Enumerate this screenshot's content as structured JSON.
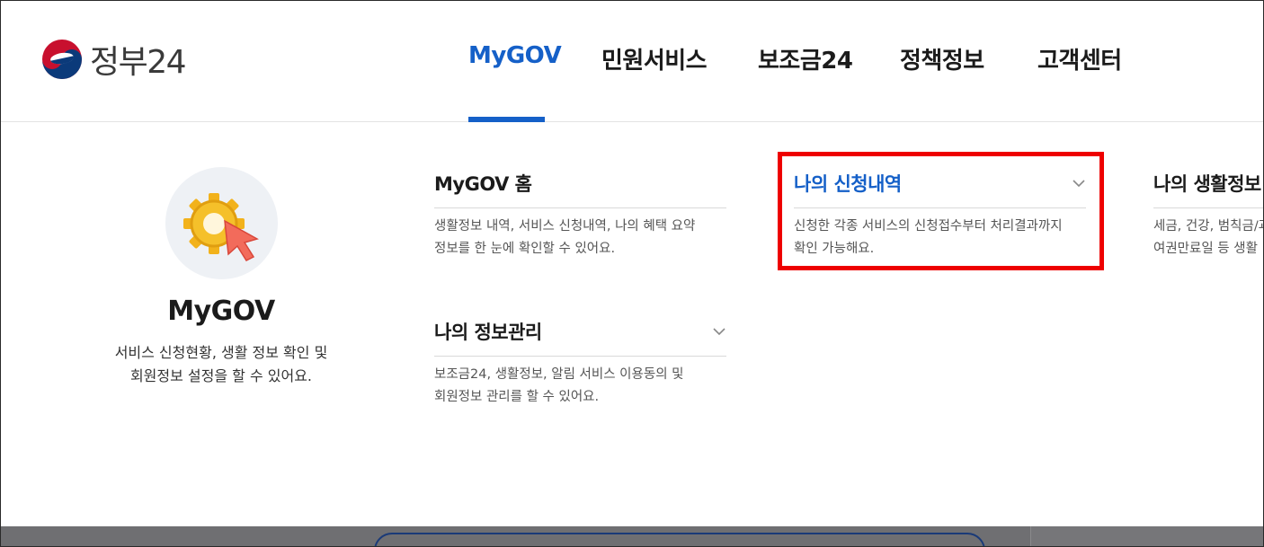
{
  "header": {
    "logo_text": "정부24",
    "nav": [
      {
        "label": "MyGOV",
        "active": true
      },
      {
        "label": "민원서비스",
        "active": false
      },
      {
        "label": "보조금24",
        "active": false
      },
      {
        "label": "정책정보",
        "active": false
      },
      {
        "label": "고객센터",
        "active": false
      }
    ]
  },
  "intro": {
    "icon": "gear-cursor-icon",
    "title": "MyGOV",
    "desc_line1": "서비스 신청현황, 생활 정보 확인 및",
    "desc_line2": "회원정보 설정을 할 수 있어요."
  },
  "menu": [
    {
      "title": "MyGOV 홈",
      "desc_line1": "생활정보 내역, 서비스 신청내역, 나의 혜택 요약",
      "desc_line2": "정보를 한 눈에 확인할 수 있어요.",
      "has_chevron": false
    },
    {
      "title": "나의 신청내역",
      "desc_line1": "신청한 각종 서비스의 신청접수부터 처리결과까지",
      "desc_line2": "확인 가능해요.",
      "has_chevron": true,
      "highlighted": true
    },
    {
      "title": "나의 생활정보",
      "desc_line1": "세금, 건강, 범칙금/과",
      "desc_line2": "여권만료일 등 생활",
      "has_chevron": false
    },
    {
      "title": "나의 정보관리",
      "desc_line1": "보조금24, 생활정보, 알림 서비스 이용동의 및",
      "desc_line2": "회원정보 관리를 할 수 있어요.",
      "has_chevron": true
    }
  ],
  "colors": {
    "accent": "#1560c8",
    "highlight_border": "#ee0000",
    "bottom_bar": "#6f6f72"
  }
}
